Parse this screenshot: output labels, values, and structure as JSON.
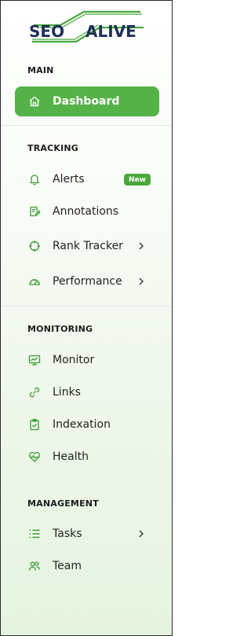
{
  "logo": {
    "text_left": "SEO",
    "text_right": "ALIVE"
  },
  "sections": {
    "main": "MAIN",
    "tracking": "TRACKING",
    "monitoring": "MONITORING",
    "management": "MANAGEMENT"
  },
  "nav": {
    "dashboard": "Dashboard",
    "alerts": "Alerts",
    "alerts_badge": "New",
    "annotations": "Annotations",
    "rank_tracker": "Rank Tracker",
    "performance": "Performance",
    "monitor": "Monitor",
    "links": "Links",
    "indexation": "Indexation",
    "health": "Health",
    "tasks": "Tasks",
    "team": "Team"
  },
  "colors": {
    "accent": "#55b248",
    "icon_green": "#3a9b33",
    "logo_navy": "#1f2f57"
  }
}
